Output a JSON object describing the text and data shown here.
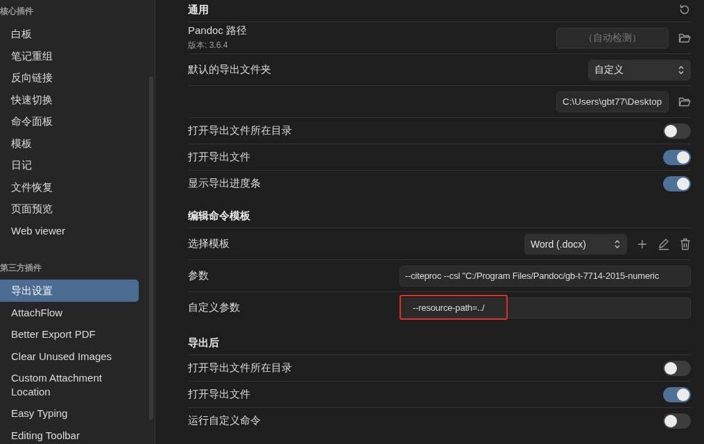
{
  "sidebar": {
    "groups": [
      {
        "title": "核心插件",
        "items": [
          {
            "label": "白板",
            "selected": false
          },
          {
            "label": "笔记重组",
            "selected": false
          },
          {
            "label": "反向链接",
            "selected": false
          },
          {
            "label": "快速切换",
            "selected": false
          },
          {
            "label": "命令面板",
            "selected": false
          },
          {
            "label": "模板",
            "selected": false
          },
          {
            "label": "日记",
            "selected": false
          },
          {
            "label": "文件恢复",
            "selected": false
          },
          {
            "label": "页面预览",
            "selected": false
          },
          {
            "label": "Web viewer",
            "selected": false
          }
        ]
      },
      {
        "title": "第三方插件",
        "items": [
          {
            "label": "导出设置",
            "selected": true
          },
          {
            "label": "AttachFlow",
            "selected": false
          },
          {
            "label": "Better Export PDF",
            "selected": false
          },
          {
            "label": "Clear Unused Images",
            "selected": false
          },
          {
            "label": "Custom Attachment Location",
            "selected": false
          },
          {
            "label": "Easy Typing",
            "selected": false
          },
          {
            "label": "Editing Toolbar",
            "selected": false
          }
        ]
      }
    ]
  },
  "sections": [
    {
      "title": "通用",
      "reset_button": true,
      "rows": [
        {
          "label": "Pandoc 路径",
          "description": "版本: 3.6.4",
          "controls": [
            {
              "kind": "input",
              "placeholder": "（自动检测）"
            },
            {
              "kind": "folder-button"
            }
          ]
        },
        {
          "label": "默认的导出文件夹",
          "controls": [
            {
              "kind": "select",
              "value": "自定义"
            }
          ]
        },
        {
          "controls": [
            {
              "kind": "input",
              "value": "C:\\Users\\gbt77\\Desktop"
            },
            {
              "kind": "folder-button"
            }
          ]
        },
        {
          "label": "打开导出文件所在目录",
          "controls": [
            {
              "kind": "toggle",
              "on": false
            }
          ]
        },
        {
          "label": "打开导出文件",
          "controls": [
            {
              "kind": "toggle",
              "on": true
            }
          ]
        },
        {
          "label": "显示导出进度条",
          "controls": [
            {
              "kind": "toggle",
              "on": true
            }
          ]
        }
      ]
    },
    {
      "title": "编辑命令模板",
      "reset_button": false,
      "rows": [
        {
          "label": "选择模板",
          "controls": [
            {
              "kind": "select",
              "value": "Word (.docx)"
            },
            {
              "kind": "add-button"
            },
            {
              "kind": "edit-button"
            },
            {
              "kind": "delete-button"
            }
          ]
        },
        {
          "label": "参数",
          "controls": [
            {
              "kind": "wide-input",
              "value": "--citeproc --csl \"C:/Program Files/Pandoc/gb-t-7714-2015-numeric"
            }
          ]
        },
        {
          "label": "自定义参数",
          "controls": [
            {
              "kind": "wide-input",
              "value": "--resource-path=../",
              "highlighted": true
            }
          ]
        }
      ]
    },
    {
      "title": "导出后",
      "reset_button": false,
      "rows": [
        {
          "label": "打开导出文件所在目录",
          "controls": [
            {
              "kind": "toggle",
              "on": false
            }
          ]
        },
        {
          "label": "打开导出文件",
          "controls": [
            {
              "kind": "toggle",
              "on": true
            }
          ]
        },
        {
          "label": "运行自定义命令",
          "controls": [
            {
              "kind": "toggle",
              "on": false
            }
          ]
        }
      ]
    }
  ]
}
